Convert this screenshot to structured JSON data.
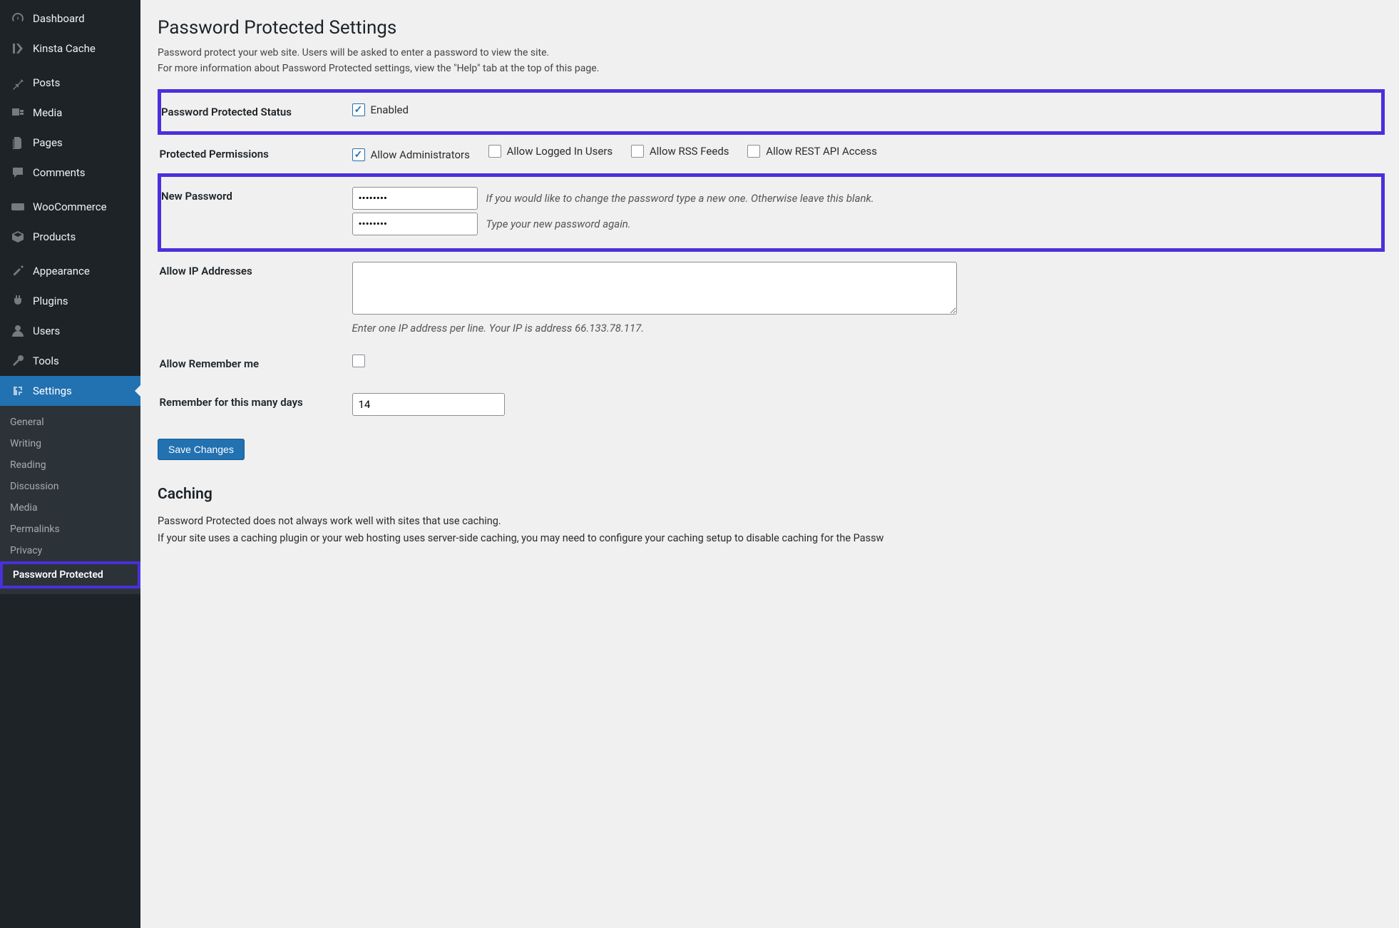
{
  "sidebar": {
    "menu": [
      {
        "label": "Dashboard",
        "icon": "dashboard"
      },
      {
        "label": "Kinsta Cache",
        "icon": "kinsta"
      },
      {
        "label": "Posts",
        "icon": "pin"
      },
      {
        "label": "Media",
        "icon": "media"
      },
      {
        "label": "Pages",
        "icon": "pages"
      },
      {
        "label": "Comments",
        "icon": "comments"
      },
      {
        "label": "WooCommerce",
        "icon": "woo"
      },
      {
        "label": "Products",
        "icon": "products"
      },
      {
        "label": "Appearance",
        "icon": "appearance"
      },
      {
        "label": "Plugins",
        "icon": "plugins"
      },
      {
        "label": "Users",
        "icon": "users"
      },
      {
        "label": "Tools",
        "icon": "tools"
      }
    ],
    "current": {
      "label": "Settings",
      "icon": "settings"
    },
    "submenu": [
      "General",
      "Writing",
      "Reading",
      "Discussion",
      "Media",
      "Permalinks",
      "Privacy"
    ],
    "submenu_active": "Password Protected"
  },
  "page": {
    "title": "Password Protected Settings",
    "desc1": "Password protect your web site. Users will be asked to enter a password to view the site.",
    "desc2": "For more information about Password Protected settings, view the \"Help\" tab at the top of this page."
  },
  "fields": {
    "status_label": "Password Protected Status",
    "status_enabled": "Enabled",
    "perm_label": "Protected Permissions",
    "perm_admin": "Allow Administrators",
    "perm_logged": "Allow Logged In Users",
    "perm_rss": "Allow RSS Feeds",
    "perm_rest": "Allow REST API Access",
    "newpw_label": "New Password",
    "newpw_hint1": "If you would like to change the password type a new one. Otherwise leave this blank.",
    "newpw_hint2": "Type your new password again.",
    "ip_label": "Allow IP Addresses",
    "ip_desc": "Enter one IP address per line. Your IP is address 66.133.78.117.",
    "remember_label": "Allow Remember me",
    "remember_days_label": "Remember for this many days",
    "remember_days_value": "14",
    "save": "Save Changes"
  },
  "caching": {
    "heading": "Caching",
    "p1": "Password Protected does not always work well with sites that use caching.",
    "p2": "If your site uses a caching plugin or your web hosting uses server-side caching, you may need to configure your caching setup to disable caching for the Passw"
  }
}
